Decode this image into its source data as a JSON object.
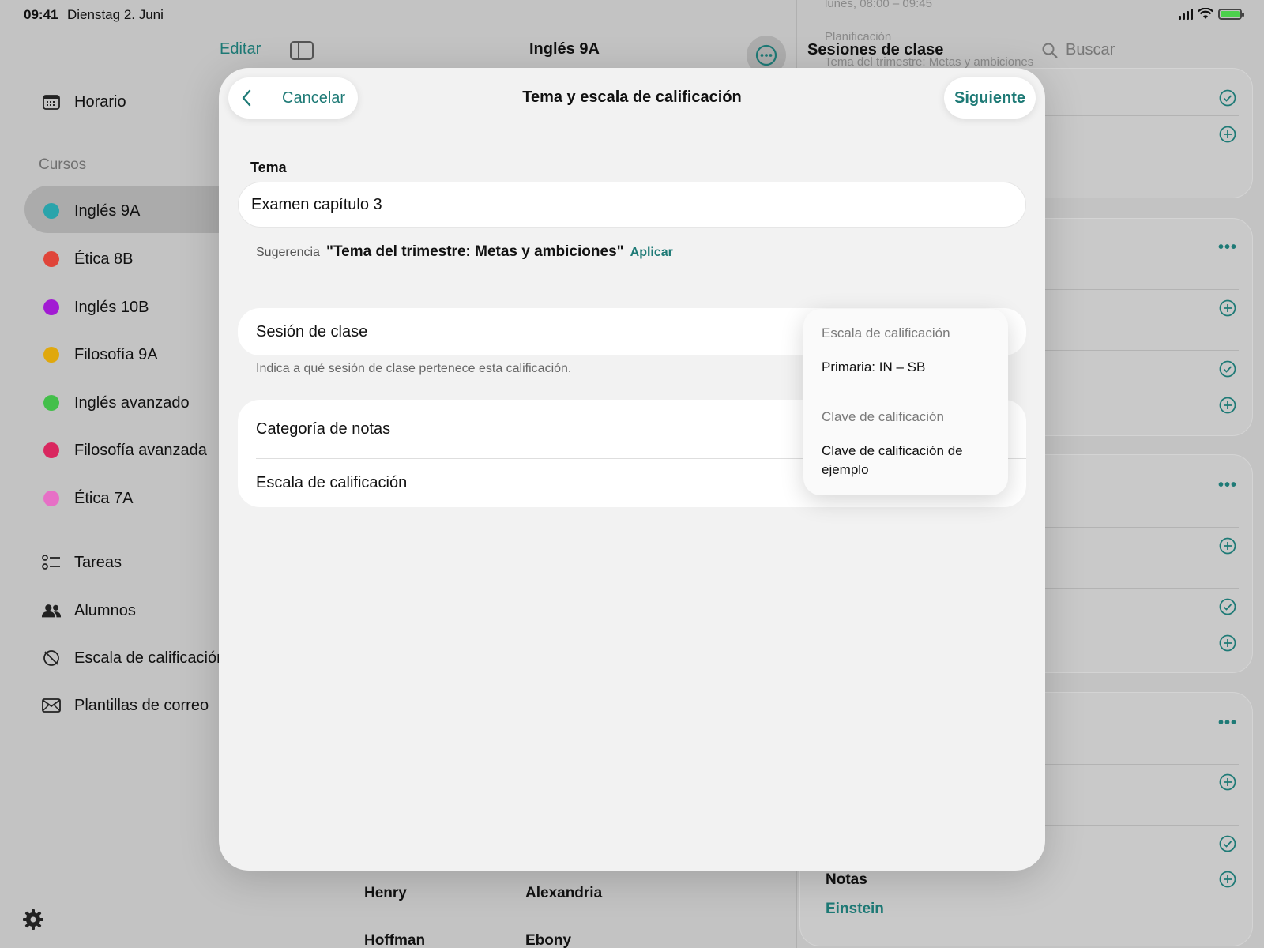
{
  "status": {
    "time": "09:41",
    "date": "Dienstag 2. Juni"
  },
  "sidebar": {
    "schedule": "Horario",
    "courses_header": "Cursos",
    "courses": [
      {
        "label": "Inglés 9A",
        "color": "#2aa4ab"
      },
      {
        "label": "Ética 8B",
        "color": "#e0453a"
      },
      {
        "label": "Inglés 10B",
        "color": "#a21bd3"
      },
      {
        "label": "Filosofía 9A",
        "color": "#e0a80d"
      },
      {
        "label": "Inglés avanzado",
        "color": "#43bf4a"
      },
      {
        "label": "Filosofía avanzada",
        "color": "#d9275f"
      },
      {
        "label": "Ética 7A",
        "color": "#e670c6"
      }
    ],
    "tasks": "Tareas",
    "students": "Alumnos",
    "grading_scale": "Escala de calificación",
    "email_templates": "Plantillas de correo"
  },
  "middle": {
    "edit": "Editar",
    "title": "Inglés 9A",
    "names": [
      "Henry",
      "Alexandria",
      "Hoffman",
      "Ebony"
    ]
  },
  "right": {
    "title": "Sesiones de clase",
    "search_placeholder": "Buscar",
    "faded_top": "lunes, 08:00 – 09:45",
    "faded_planning": "Planificación",
    "faded_theme": "Tema del trimestre: Metas y ambiciones",
    "notes_label": "Notas",
    "notes_value": "Einstein"
  },
  "modal": {
    "back_label": "Cancelar",
    "title": "Tema y escala de calificación",
    "next_label": "Siguiente",
    "topic_label": "Tema",
    "topic_value": "Examen capítulo 3",
    "suggestion_label": "Sugerencia",
    "suggestion_text": "\"Tema del trimestre: Metas y ambiciones\"",
    "suggestion_apply": "Aplicar",
    "session_row": "Sesión de clase",
    "session_hint": "Indica a qué sesión de clase pertenece esta calificación.",
    "category_row": "Categoría de notas",
    "scale_row": "Escala de calificación"
  },
  "menu": {
    "scale_header": "Escala de calificación",
    "scale_value": "Primaria: IN – SB",
    "key_header": "Clave de calificación",
    "key_value": "Clave de calificación de ejemplo"
  },
  "colors": {
    "accent": "#1e7a76"
  }
}
